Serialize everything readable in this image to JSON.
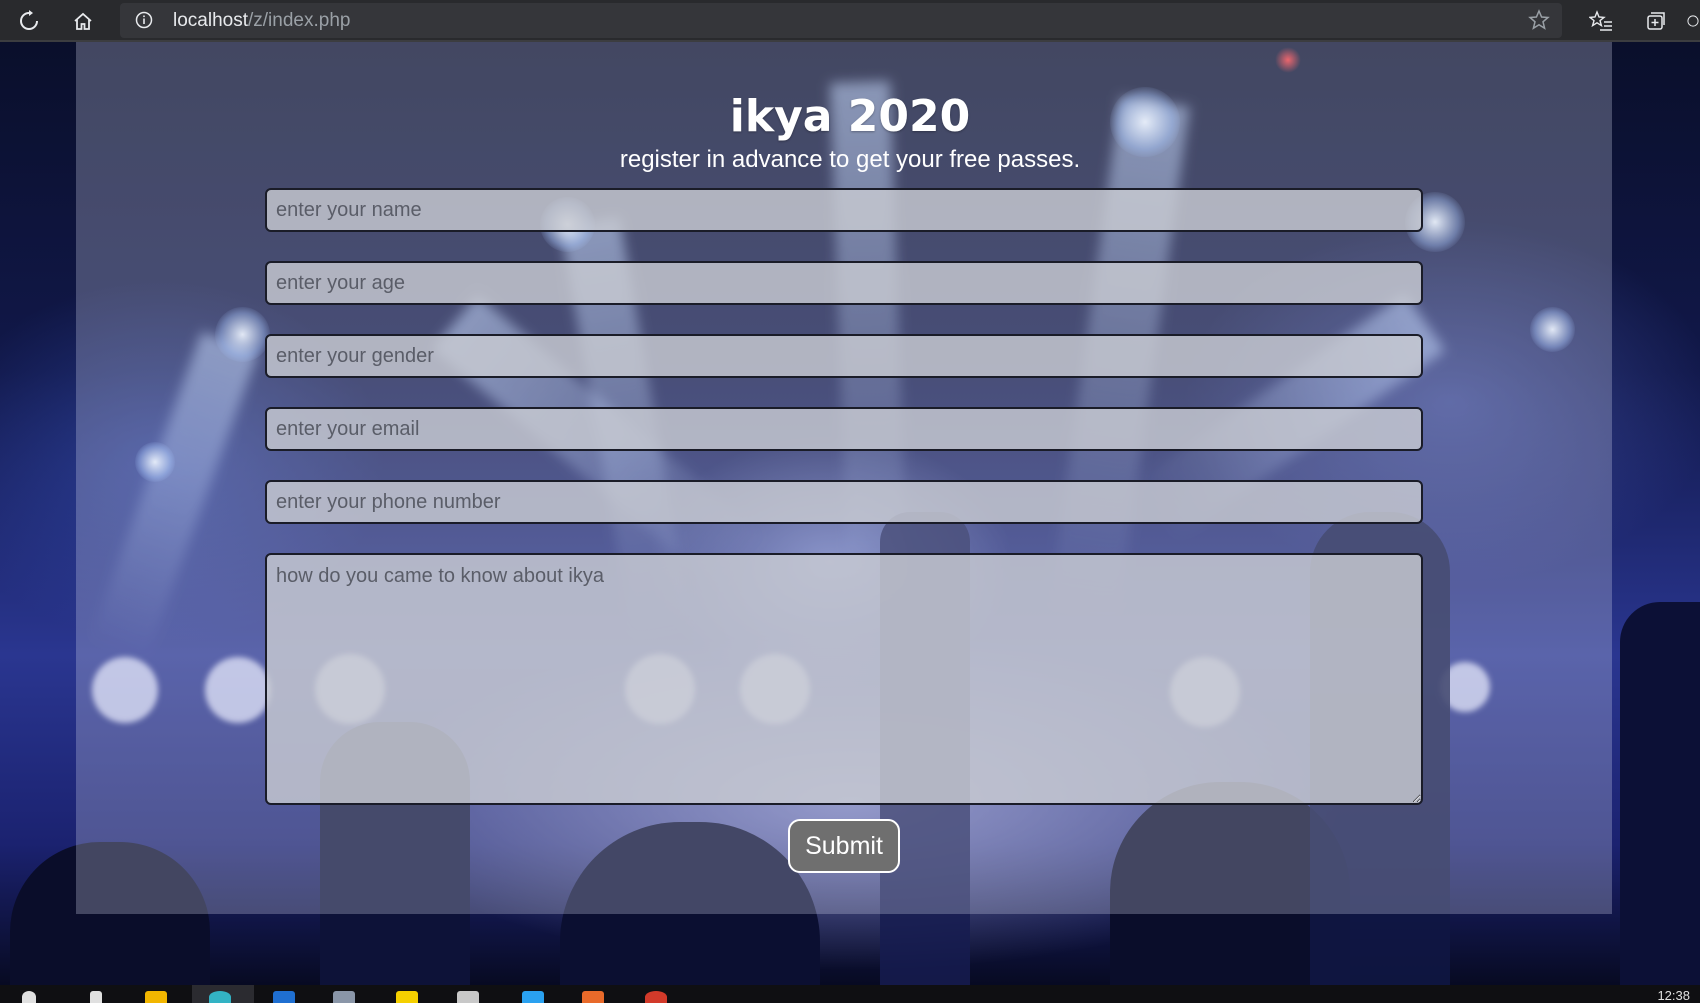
{
  "browser": {
    "url_host": "localhost",
    "url_path": "/z/index.php",
    "icons": [
      "reload-icon",
      "home-icon",
      "site-info-icon",
      "favorite-star-icon",
      "favorites-list-icon",
      "collections-icon"
    ]
  },
  "page": {
    "title": "ikya 2020",
    "subtitle": "register in advance to get your free passes.",
    "form": {
      "name_placeholder": "enter your name",
      "age_placeholder": "enter your age",
      "gender_placeholder": "enter your gender",
      "email_placeholder": "enter your email",
      "phone_placeholder": "enter your phone number",
      "source_placeholder": "how do you came to know about ikya",
      "submit_label": "Submit"
    }
  },
  "taskbar": {
    "clock": "12:38",
    "colors": {
      "folder": "#f2b600",
      "edge": "#33b3c4",
      "store": "#1f6fd1",
      "vscode": "#2aa1f0",
      "sticky": "#f5d000",
      "app_orange": "#e86a2a",
      "app_red": "#d23a2a"
    }
  }
}
